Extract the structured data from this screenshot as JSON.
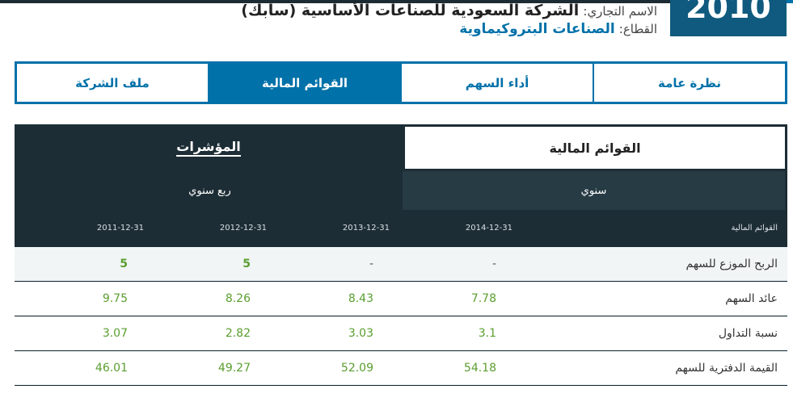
{
  "company": {
    "year_badge": "2010",
    "trade_name_label": "الاسم التجاري:",
    "trade_name": "الشركة السعودية للصناعات الأساسية (سابك)",
    "sector_label": "القطاع:",
    "sector": "الصناعات البتروكيماوية"
  },
  "tabs": [
    {
      "label": "نظرة عامة",
      "active": false
    },
    {
      "label": "أداء السهم",
      "active": false
    },
    {
      "label": "القوائم المالية",
      "active": true
    },
    {
      "label": "ملف الشركة",
      "active": false
    }
  ],
  "panel": {
    "financial_statements_tab": "القوائم المالية",
    "indicators_tab": "المؤشرات",
    "annual": "سنوي",
    "quarterly": "ربع سنوي"
  },
  "table": {
    "header_label": "القوائم المالية",
    "dates": [
      "2014-12-31",
      "2013-12-31",
      "2012-12-31",
      "2011-12-31"
    ],
    "rows": [
      {
        "label": "الربح الموزع للسهم",
        "values": [
          "-",
          "-",
          "5",
          "5"
        ]
      },
      {
        "label": "عائد السهم",
        "values": [
          "7.78",
          "8.43",
          "8.26",
          "9.75"
        ]
      },
      {
        "label": "نسبة التداول",
        "values": [
          "3.1",
          "3.03",
          "2.82",
          "3.07"
        ]
      },
      {
        "label": "القيمة الدفترية للسهم",
        "values": [
          "54.18",
          "52.09",
          "49.27",
          "46.01"
        ]
      }
    ]
  },
  "colors": {
    "brand_blue": "#0071a9",
    "dark_panel": "#1d2d35",
    "value_green": "#5a9e2f"
  }
}
